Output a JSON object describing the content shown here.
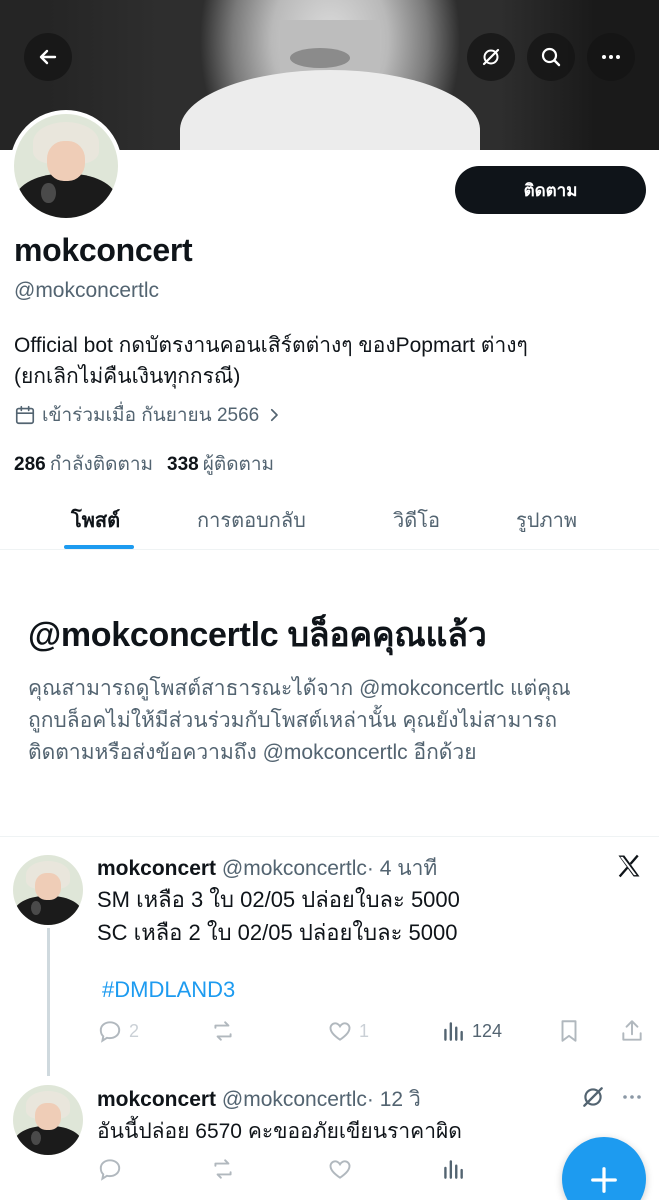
{
  "profile": {
    "display_name": "mokconcert",
    "handle": "@mokconcertlc",
    "bio_line1": "Official bot กดบัตรงานคอนเสิร์ตต่างๆ ของPopmart ต่างๆ",
    "bio_line2": "(ยกเลิกไม่คืนเงินทุกกรณี)",
    "joined": "เข้าร่วมเมื่อ กันยายน 2566",
    "following_count": "286",
    "following_label": "กำลังติดตาม",
    "followers_count": "338",
    "followers_label": "ผู้ติดตาม",
    "follow_button": "ติดตาม"
  },
  "tabs": [
    {
      "label": "โพสต์",
      "active": true
    },
    {
      "label": "การตอบกลับ",
      "active": false
    },
    {
      "label": "วิดีโอ",
      "active": false
    },
    {
      "label": "รูปภาพ",
      "active": false
    }
  ],
  "blocked": {
    "title": "@mokconcertlc บล็อคคุณแล้ว",
    "line1": "คุณสามารถดูโพสต์สาธารณะได้จาก @mokconcertlc แต่คุณ",
    "line2": "ถูกบล็อคไม่ให้มีส่วนร่วมกับโพสต์เหล่านั้น คุณยังไม่สามารถ",
    "line3": "ติดตามหรือส่งข้อความถึง @mokconcertlc อีกด้วย"
  },
  "posts": [
    {
      "name": "mokconcert",
      "handle": "@mokconcertlc",
      "time": "· 4 นาที",
      "line1": "SM เหลือ 3 ใบ 02/05 ปล่อยใบละ 5000",
      "line2": "SC เหลือ 2 ใบ 02/05 ปล่อยใบละ 5000",
      "hashtag": "#DMDLAND3",
      "replies": "2",
      "likes": "1",
      "views": "124"
    },
    {
      "name": "mokconcert",
      "handle": "@mokconcertlc",
      "time": "· 12 วิ",
      "line1": "อันนี้ปล่อย 6570 คะขออภัยเขียนราคาผิด"
    }
  ],
  "icons": {
    "back": "arrow-left-icon",
    "grok": "grok-icon",
    "search": "search-icon",
    "more": "more-icon",
    "calendar": "calendar-icon",
    "x_logo": "x-logo-icon",
    "reply": "reply-icon",
    "repost": "repost-icon",
    "like": "heart-icon",
    "views": "views-icon",
    "bookmark": "bookmark-icon",
    "share": "share-icon",
    "compose": "plus-icon"
  },
  "colors": {
    "accent": "#1d9bf0",
    "text_primary": "#0f1419",
    "text_secondary": "#536471"
  }
}
